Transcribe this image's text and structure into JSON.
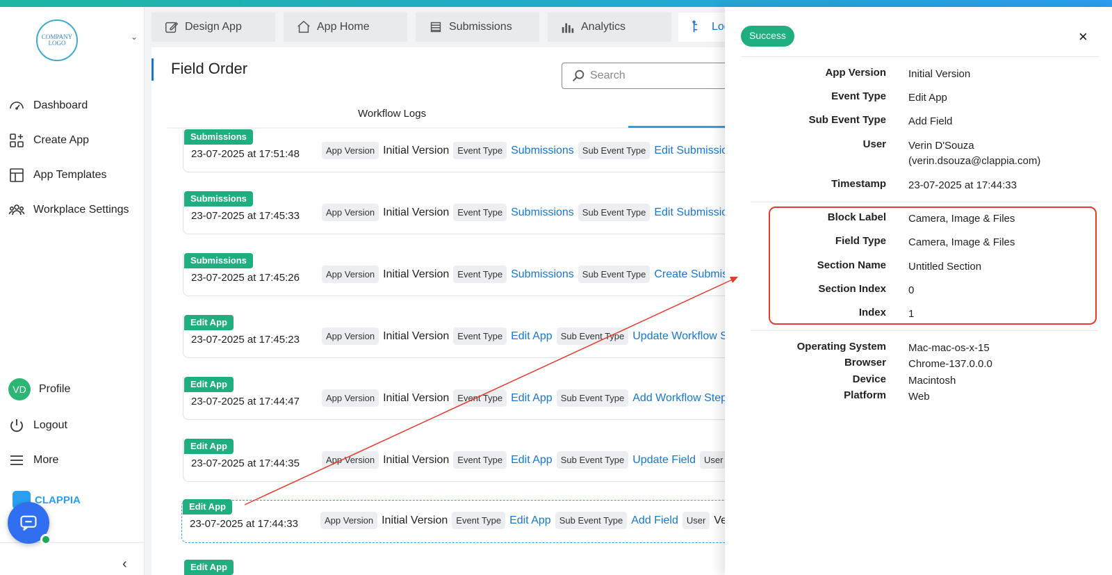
{
  "sidebar": {
    "logo_text": "COMPANY LOGO",
    "items": [
      {
        "label": "Dashboard",
        "icon": "gauge-icon"
      },
      {
        "label": "Create App",
        "icon": "grid-plus-icon"
      },
      {
        "label": "App Templates",
        "icon": "template-icon"
      },
      {
        "label": "Workplace Settings",
        "icon": "users-icon"
      }
    ],
    "profile": {
      "initials": "VD",
      "label": "Profile"
    },
    "logout_label": "Logout",
    "more_label": "More",
    "brand": "CLAPPIA"
  },
  "tabs": [
    {
      "label": "Design App",
      "icon": "edit-icon"
    },
    {
      "label": "App Home",
      "icon": "home-icon"
    },
    {
      "label": "Submissions",
      "icon": "list-icon"
    },
    {
      "label": "Analytics",
      "icon": "bar-chart-icon"
    },
    {
      "label": "Log",
      "icon": "log-icon"
    }
  ],
  "page": {
    "title": "Field Order",
    "search_placeholder": "Search",
    "subtab": "Workflow Logs"
  },
  "logs": [
    {
      "badge": "Submissions",
      "timestamp": "23-07-2025 at 17:51:48",
      "app_version_key": "App Version",
      "app_version": "Initial Version",
      "event_type_key": "Event Type",
      "event_type": "Submissions",
      "sub_event_key": "Sub Event Type",
      "sub_event": "Edit Submission"
    },
    {
      "badge": "Submissions",
      "timestamp": "23-07-2025 at 17:45:33",
      "app_version_key": "App Version",
      "app_version": "Initial Version",
      "event_type_key": "Event Type",
      "event_type": "Submissions",
      "sub_event_key": "Sub Event Type",
      "sub_event": "Edit Submission"
    },
    {
      "badge": "Submissions",
      "timestamp": "23-07-2025 at 17:45:26",
      "app_version_key": "App Version",
      "app_version": "Initial Version",
      "event_type_key": "Event Type",
      "event_type": "Submissions",
      "sub_event_key": "Sub Event Type",
      "sub_event": "Create Submiss"
    },
    {
      "badge": "Edit App",
      "timestamp": "23-07-2025 at 17:45:23",
      "app_version_key": "App Version",
      "app_version": "Initial Version",
      "event_type_key": "Event Type",
      "event_type": "Edit App",
      "sub_event_key": "Sub Event Type",
      "sub_event": "Update Workflow St"
    },
    {
      "badge": "Edit App",
      "timestamp": "23-07-2025 at 17:44:47",
      "app_version_key": "App Version",
      "app_version": "Initial Version",
      "event_type_key": "Event Type",
      "event_type": "Edit App",
      "sub_event_key": "Sub Event Type",
      "sub_event": "Add Workflow Step"
    },
    {
      "badge": "Edit App",
      "timestamp": "23-07-2025 at 17:44:35",
      "app_version_key": "App Version",
      "app_version": "Initial Version",
      "event_type_key": "Event Type",
      "event_type": "Edit App",
      "sub_event_key": "Sub Event Type",
      "sub_event": "Update Field",
      "user_key": "User"
    },
    {
      "badge": "Edit App",
      "timestamp": "23-07-2025 at 17:44:33",
      "app_version_key": "App Version",
      "app_version": "Initial Version",
      "event_type_key": "Event Type",
      "event_type": "Edit App",
      "sub_event_key": "Sub Event Type",
      "sub_event": "Add Field",
      "user_key": "User",
      "user": "Veri"
    },
    {
      "badge": "Edit App"
    }
  ],
  "drawer": {
    "status": "Success",
    "close": "×",
    "general": [
      {
        "key": "App Version",
        "value": "Initial Version"
      },
      {
        "key": "Event Type",
        "value": "Edit App"
      },
      {
        "key": "Sub Event Type",
        "value": "Add Field"
      },
      {
        "key": "User",
        "value": "Verin D'Souza",
        "value2": "(verin.dsouza@clappia.com)"
      },
      {
        "key": "Timestamp",
        "value": "23-07-2025 at 17:44:33"
      }
    ],
    "details": [
      {
        "key": "Block Label",
        "value": "Camera, Image & Files"
      },
      {
        "key": "Field Type",
        "value": "Camera, Image & Files"
      },
      {
        "key": "Section Name",
        "value": "Untitled Section"
      },
      {
        "key": "Section Index",
        "value": "0"
      },
      {
        "key": "Index",
        "value": "1"
      }
    ],
    "device": [
      {
        "key": "Operating System",
        "value": "Mac-mac-os-x-15"
      },
      {
        "key": "Browser",
        "value": "Chrome-137.0.0.0"
      },
      {
        "key": "Device",
        "value": "Macintosh"
      },
      {
        "key": "Platform",
        "value": "Web"
      }
    ]
  },
  "colors": {
    "accent": "#1677d2",
    "success": "#1fae7f",
    "highlight": "#e53b2c"
  }
}
